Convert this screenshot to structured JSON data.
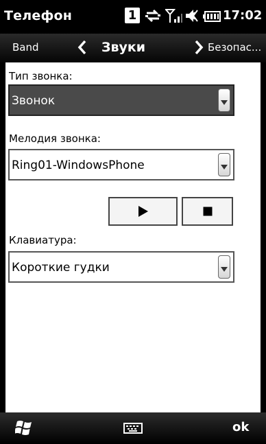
{
  "statusbar": {
    "title": "Телефон",
    "sim_number": "1",
    "time": "17:02",
    "icons": [
      "sim-1-icon",
      "data-transfer-icon",
      "signal-icon",
      "volume-icon",
      "battery-icon"
    ]
  },
  "nav": {
    "previous": "Band",
    "current": "Звуки",
    "next": "Безопас..."
  },
  "form": {
    "ring_type_label": "Тип звонка:",
    "ring_type_value": "Звонок",
    "ringtone_label": "Мелодия звонка:",
    "ringtone_value": "Ring01-WindowsPhone",
    "keypad_label": "Клавиатура:",
    "keypad_value": "Короткие гудки"
  },
  "controls": {
    "play_icon": "play-icon",
    "stop_icon": "stop-icon"
  },
  "bottombar": {
    "start_icon": "windows-flag-icon",
    "keyboard_icon": "keyboard-icon",
    "ok_label": "ok"
  },
  "colors": {
    "selected_field": "#4a4a4a",
    "bar_background": "#000000",
    "content_background": "#ffffff"
  }
}
